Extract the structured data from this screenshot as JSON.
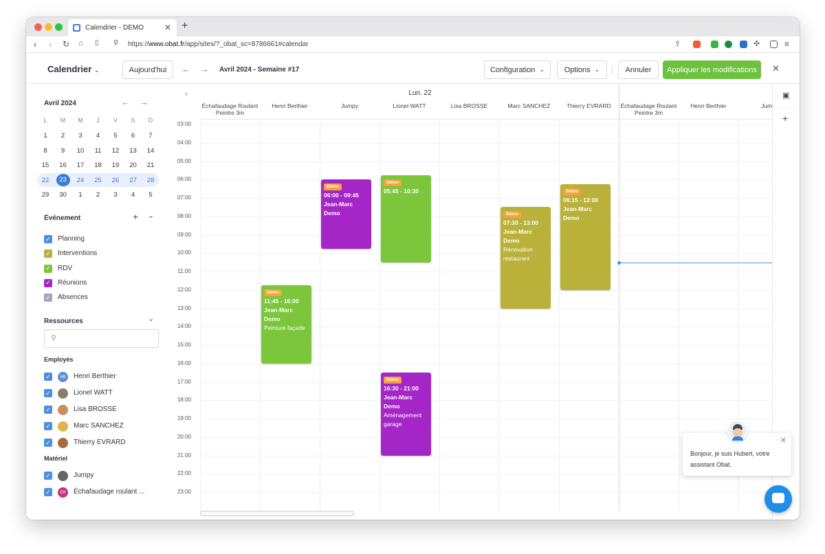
{
  "browser": {
    "tab_title": "Calendrier - DEMO",
    "url_prefix": "https://",
    "url_host": "www.obat.fr",
    "url_path": "/app/sites/?_obat_sc=8786661#calendar"
  },
  "header": {
    "title": "Calendrier",
    "today_label": "Aujourd'hui",
    "period": "Avril 2024 - Semaine #17",
    "configuration_label": "Configuration",
    "options_label": "Options",
    "cancel_label": "Annuler",
    "apply_label": "Appliquer les modifications"
  },
  "mini_calendar": {
    "month": "Avril 2024",
    "weekdays": [
      "L",
      "M",
      "M",
      "J",
      "V",
      "S",
      "D"
    ],
    "weeks": [
      [
        "1",
        "2",
        "3",
        "4",
        "5",
        "6",
        "7"
      ],
      [
        "8",
        "9",
        "10",
        "11",
        "12",
        "13",
        "14"
      ],
      [
        "15",
        "16",
        "17",
        "18",
        "19",
        "20",
        "21"
      ],
      [
        "22",
        "23",
        "24",
        "25",
        "26",
        "27",
        "28"
      ],
      [
        "29",
        "30",
        "1",
        "2",
        "3",
        "4",
        "5"
      ]
    ],
    "today": "23"
  },
  "events_filter": {
    "title": "Événement",
    "items": [
      {
        "label": "Planning",
        "color": "#4a90e2"
      },
      {
        "label": "Interventions",
        "color": "#b9b13a"
      },
      {
        "label": "RDV",
        "color": "#7cc63c"
      },
      {
        "label": "Réunions",
        "color": "#a526c6"
      },
      {
        "label": "Absences",
        "color": "#a3a7c4"
      }
    ]
  },
  "resources": {
    "title": "Ressources",
    "employees_title": "Employés",
    "employees": [
      {
        "name": "Henri Berthier",
        "initials": "HB",
        "color": "#5b8ed6"
      },
      {
        "name": "Lionel WATT",
        "initials": "",
        "color": "#8d7b6d"
      },
      {
        "name": "Lisa BROSSE",
        "initials": "",
        "color": "#c98f5d"
      },
      {
        "name": "Marc SANCHEZ",
        "initials": "",
        "color": "#e0b34b"
      },
      {
        "name": "Thierry EVRARD",
        "initials": "",
        "color": "#a86a43"
      }
    ],
    "equipment_title": "Matériel",
    "equipment": [
      {
        "name": "Jumpy",
        "initials": "",
        "color": "#666666"
      },
      {
        "name": "Échafaudage roulant ...",
        "initials": "ER",
        "color": "#c2337a"
      }
    ]
  },
  "calendar": {
    "day_label": "Lun. 22",
    "columns": [
      "Échafaudage Roulant Peintre 3m",
      "Henri Berthier",
      "Jumpy",
      "Lionel WATT",
      "Lisa BROSSE",
      "Marc SANCHEZ",
      "Thierry EVRARD",
      "Échafaudage Roulant Peintre 3m",
      "Henri Berthier",
      "Jump"
    ],
    "hours": [
      "03:00",
      "04:00",
      "05:00",
      "06:00",
      "07:00",
      "08:00",
      "09:00",
      "10:00",
      "11:00",
      "12:00",
      "13:00",
      "14:00",
      "15:00",
      "16:00",
      "17:00",
      "18:00",
      "19:00",
      "20:00",
      "21:00",
      "22:00",
      "23:00"
    ],
    "events": [
      {
        "column": 2,
        "start": 6.0,
        "end": 9.75,
        "badge": "Démo",
        "time": "06:00 - 09:45",
        "who": "Jean-Marc Demo",
        "desc": "",
        "color": "#a526c6"
      },
      {
        "column": 3,
        "start": 5.75,
        "end": 10.5,
        "badge": "Démo",
        "time": "05:45 - 10:30",
        "who": "",
        "desc": "",
        "color": "#7cc63c"
      },
      {
        "column": 5,
        "start": 7.5,
        "end": 13.0,
        "badge": "Démo",
        "time": "07:30 - 13:00",
        "who": "Jean-Marc Demo",
        "desc": "Rénovation restaurant",
        "color": "#b9b13a"
      },
      {
        "column": 6,
        "start": 6.25,
        "end": 12.0,
        "badge": "Démo",
        "time": "06:15 - 12:00",
        "who": "Jean-Marc Demo",
        "desc": "",
        "color": "#b9b13a"
      },
      {
        "column": 1,
        "start": 11.75,
        "end": 16.0,
        "badge": "Démo",
        "time": "11:45 - 16:00",
        "who": "Jean-Marc Demo",
        "desc": "Peinture façade",
        "color": "#7cc63c"
      },
      {
        "column": 3,
        "start": 16.5,
        "end": 21.0,
        "badge": "Démo",
        "time": "16:30 - 21:00",
        "who": "Jean-Marc Demo",
        "desc": "Aménagement garage",
        "color": "#a526c6"
      }
    ],
    "now_hour": 10.5
  },
  "chat": {
    "message": "Bonjour, je suis Hubert, votre assistant Obat."
  },
  "colors": {
    "accent": "#4a90e2",
    "apply_green": "#6cc13d"
  }
}
